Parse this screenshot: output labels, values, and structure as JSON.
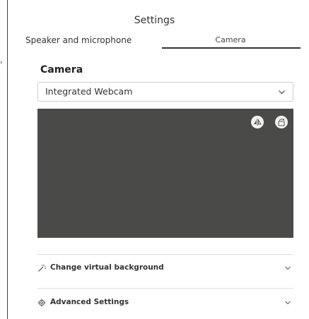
{
  "window": {
    "title": "Settings"
  },
  "tabs": [
    {
      "label": "Speaker and microphone",
      "selected": false
    },
    {
      "label": "Camera",
      "selected": true
    }
  ],
  "camera_section": {
    "heading": "Camera",
    "device_select": {
      "selected_value": "Integrated Webcam",
      "icon": "chevron-down-icon"
    },
    "preview": {
      "background_color": "#4a4a48",
      "buttons": [
        {
          "icon": "mirror-icon"
        },
        {
          "icon": "rotate-icon"
        }
      ]
    }
  },
  "expandable_rows": [
    {
      "label": "Change virtual background",
      "icon": "magic-wand-icon",
      "expand_icon": "chevron-down-icon"
    },
    {
      "label": "Advanced Settings",
      "icon": "gear-icon",
      "expand_icon": "chevron-down-icon"
    }
  ]
}
